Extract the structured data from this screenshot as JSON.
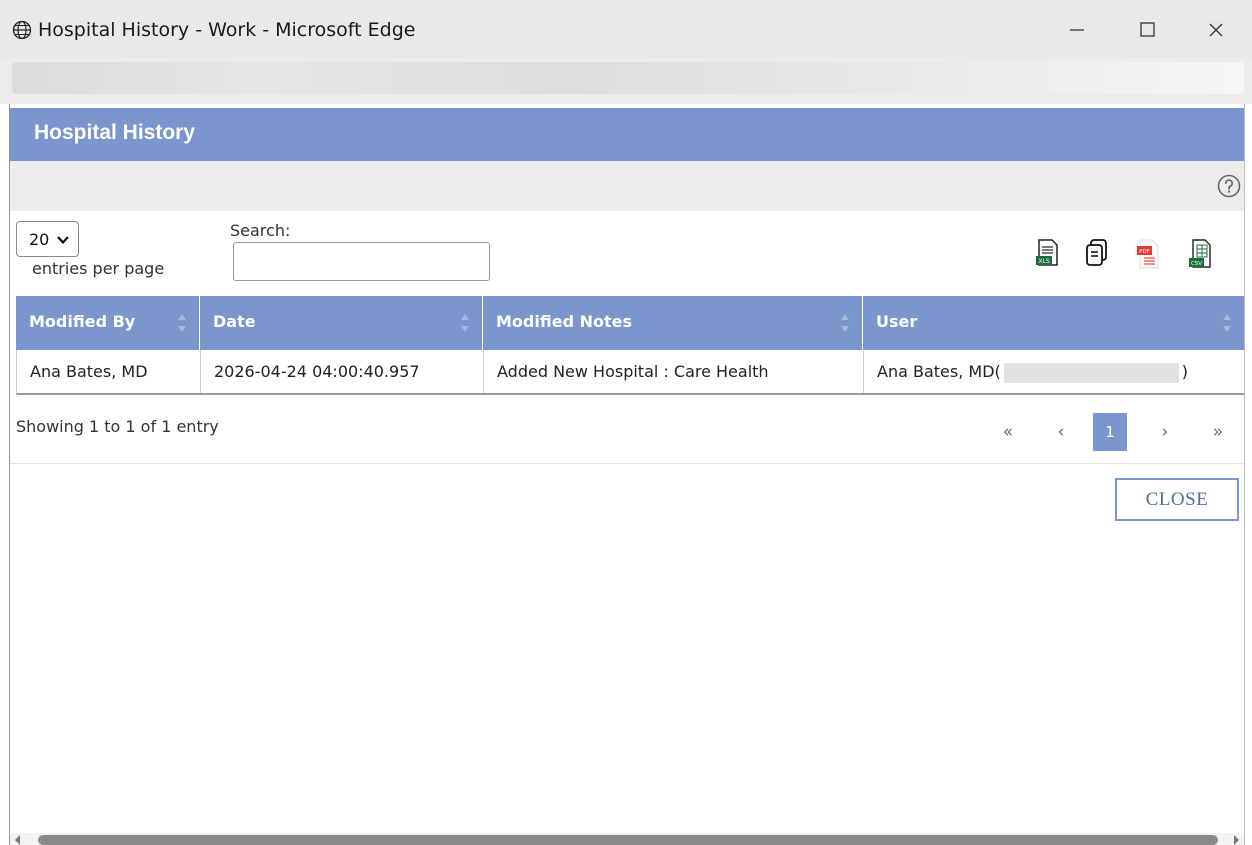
{
  "window": {
    "title": "Hospital History - Work - Microsoft Edge"
  },
  "page": {
    "heading": "Hospital History"
  },
  "controls": {
    "entries_value": "20",
    "entries_label": "entries per page",
    "search_label": "Search:",
    "search_value": "",
    "export_icons": [
      "excel-export-icon",
      "copy-icon",
      "pdf-export-icon",
      "csv-export-icon"
    ]
  },
  "table": {
    "columns": [
      "Modified By",
      "Date",
      "Modified Notes",
      "User"
    ],
    "rows": [
      {
        "modified_by": "Ana Bates, MD",
        "date": "2026-04-24 04:00:40.957",
        "modified_notes": "Added New Hospital : Care Health",
        "user_prefix": "Ana Bates, MD(",
        "user_suffix": ")"
      }
    ]
  },
  "footer": {
    "showing": "Showing 1 to 1 of 1 entry",
    "pager": {
      "first": "«",
      "prev": "‹",
      "current": "1",
      "next": "›",
      "last": "»"
    }
  },
  "buttons": {
    "close_label": "CLOSE"
  },
  "colors": {
    "accent": "#7b96cc",
    "bar_gray": "#ececec"
  }
}
